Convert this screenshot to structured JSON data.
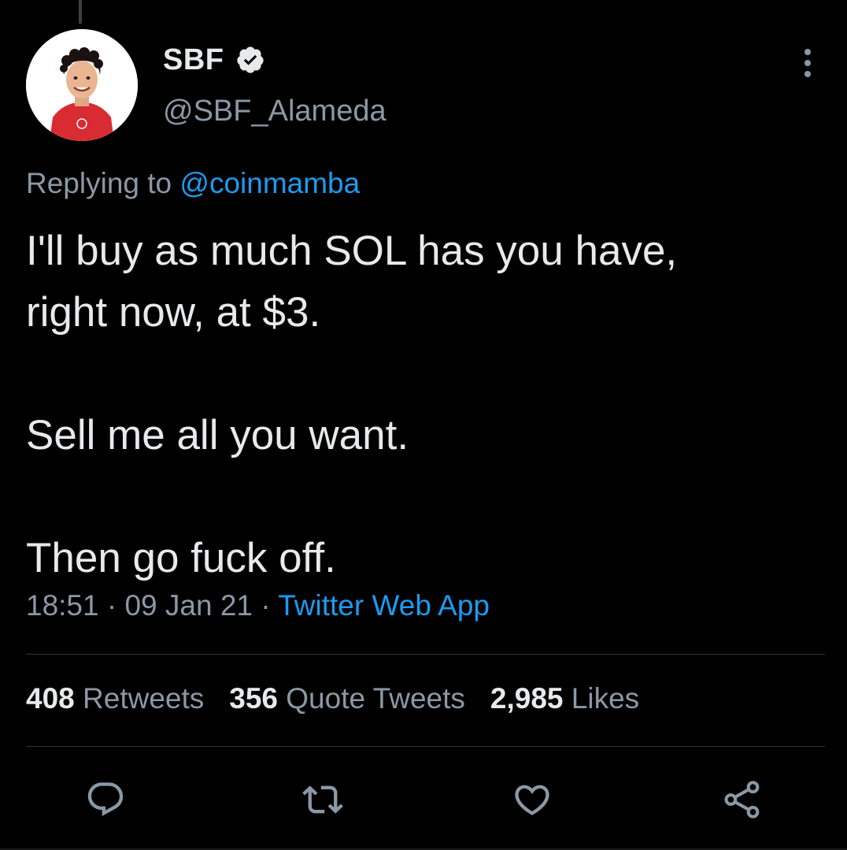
{
  "author": {
    "display_name": "SBF",
    "handle": "@SBF_Alameda",
    "verified": true
  },
  "reply": {
    "prefix": "Replying to",
    "mention": "@coinmamba"
  },
  "tweet": {
    "line1": "I'll buy as much SOL has you have,",
    "line2": "right now, at $3.",
    "line3": "Sell me all you want.",
    "line4": "Then go fuck off."
  },
  "meta": {
    "time": "18:51",
    "separator": "·",
    "date": "09 Jan 21",
    "source": "Twitter Web App"
  },
  "stats": {
    "retweets_count": "408",
    "retweets_label": "Retweets",
    "quotes_count": "356",
    "quotes_label": "Quote Tweets",
    "likes_count": "2,985",
    "likes_label": "Likes"
  },
  "icons": {
    "more": "more-vertical-icon",
    "reply": "reply-icon",
    "retweet": "retweet-icon",
    "like": "heart-icon",
    "share": "share-icon",
    "verified": "verified-badge-icon"
  },
  "colors": {
    "background": "#000000",
    "text_primary": "#e7e9ea",
    "text_secondary": "#8b98a5",
    "link": "#1d9bf0",
    "divider": "#2f3336",
    "avatar_shirt": "#d92b32"
  }
}
